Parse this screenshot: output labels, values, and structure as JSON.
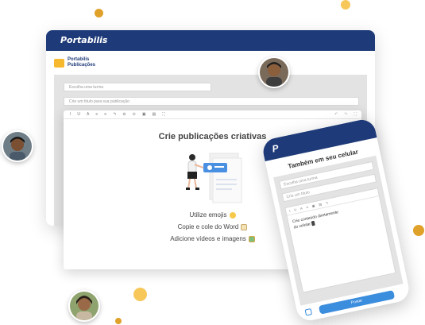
{
  "colors": {
    "brand_navy": "#1e3a78",
    "accent_yellow": "#f5b82e",
    "button_blue": "#3b8ddd",
    "dot_orange": "#e0a12a",
    "dot_yellow": "#f7c75a"
  },
  "desktop": {
    "brand": "Portabilis",
    "sub_brand_line1": "Portabilis",
    "sub_brand_line2": "Publicações",
    "class_placeholder": "Escolha uma turma",
    "title_placeholder": "Crie um título para sua publicação",
    "toolbar": [
      "I",
      "U",
      "A",
      "≡",
      "≡",
      "↰",
      "⊘",
      "⊙",
      "▣",
      "▤",
      "⛶"
    ],
    "toolbar_right": [
      "↶",
      "↷",
      "⛶"
    ],
    "editor_title": "Crie publicações criativas",
    "features": [
      {
        "text": "Utilize emojis",
        "icon": "smile-emoji-icon"
      },
      {
        "text": "Copie e cole do Word",
        "icon": "memo-emoji-icon"
      },
      {
        "text": "Adicione vídeos e imagens",
        "icon": "picture-emoji-icon"
      }
    ]
  },
  "phone": {
    "logo": "P",
    "title": "Também em seu celular",
    "class_placeholder": "Escolha uma turma",
    "title_placeholder": "Crie um título",
    "toolbar": [
      "I",
      "U",
      "A",
      "≡",
      "▣",
      "▤",
      "↰"
    ],
    "content_line1": "Crie conteúdo diretamente",
    "content_line2": "do celular",
    "post_button": "Postar"
  }
}
